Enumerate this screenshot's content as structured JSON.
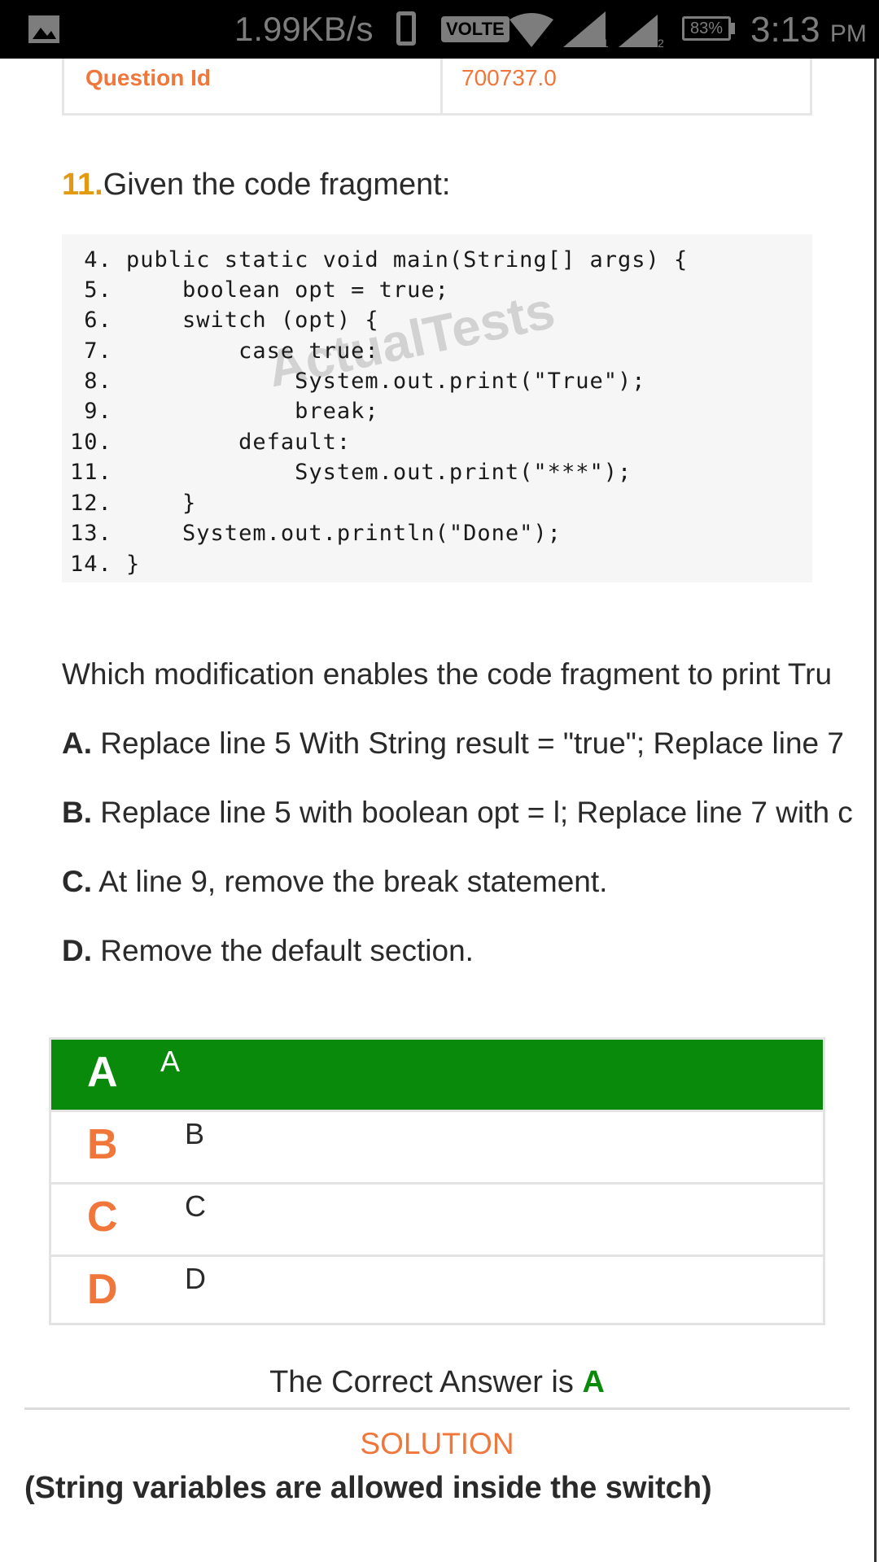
{
  "status_bar": {
    "speed": "1.99KB/s",
    "volte": "VOLTE",
    "sim1": "1",
    "sim2": "2",
    "battery": "83%",
    "time": "3:13",
    "ampm": "PM",
    "icons": [
      "gallery-icon",
      "phone-icon",
      "wifi-icon",
      "signal-icon",
      "battery-icon"
    ]
  },
  "question_meta": {
    "label": "Question Id",
    "value": "700737.0"
  },
  "question": {
    "number": "11.",
    "title": "Given the code fragment:",
    "code_lines": [
      " 4. public static void main(String[] args) {",
      " 5.     boolean opt = true;",
      " 6.     switch (opt) {",
      " 7.         case true:",
      " 8.             System.out.print(\"True\");",
      " 9.             break;",
      "10.         default:",
      "11.             System.out.print(\"***\");",
      "12.     }",
      "13.     System.out.println(\"Done\");",
      "14. }"
    ],
    "watermark": "ActualTests",
    "prompt": "Which modification enables the code fragment to print Tru",
    "options": [
      {
        "letter": "A.",
        "text": " Replace line 5 With String result = \"true\"; Replace line 7 "
      },
      {
        "letter": "B.",
        "text": " Replace line 5 with boolean opt = l; Replace line 7 with c"
      },
      {
        "letter": "C.",
        "text": " At line 9, remove the break statement."
      },
      {
        "letter": "D.",
        "text": " Remove the default section."
      }
    ]
  },
  "answers": [
    {
      "letter": "A",
      "text": "A",
      "selected": true
    },
    {
      "letter": "B",
      "text": "B",
      "selected": false
    },
    {
      "letter": "C",
      "text": "C",
      "selected": false
    },
    {
      "letter": "D",
      "text": "D",
      "selected": false
    }
  ],
  "result": {
    "prefix": "The Correct Answer is ",
    "answer": "A"
  },
  "solution": {
    "title": "SOLUTION",
    "text": "(String variables are allowed inside the switch)"
  },
  "colors": {
    "accent_orange": "#f0763a",
    "question_number": "#e39a12",
    "correct_green": "#0a8a0a"
  }
}
